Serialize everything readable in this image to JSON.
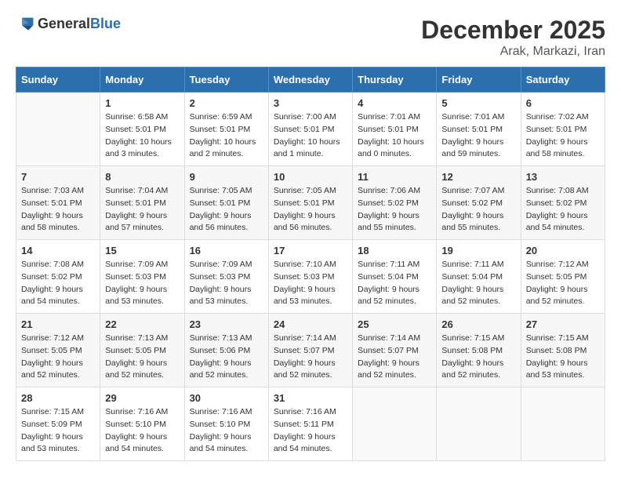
{
  "logo": {
    "general": "General",
    "blue": "Blue"
  },
  "header": {
    "month_year": "December 2025",
    "location": "Arak, Markazi, Iran"
  },
  "days_of_week": [
    "Sunday",
    "Monday",
    "Tuesday",
    "Wednesday",
    "Thursday",
    "Friday",
    "Saturday"
  ],
  "weeks": [
    [
      {
        "day": "",
        "sunrise": "",
        "sunset": "",
        "daylight": ""
      },
      {
        "day": "1",
        "sunrise": "Sunrise: 6:58 AM",
        "sunset": "Sunset: 5:01 PM",
        "daylight": "Daylight: 10 hours and 3 minutes."
      },
      {
        "day": "2",
        "sunrise": "Sunrise: 6:59 AM",
        "sunset": "Sunset: 5:01 PM",
        "daylight": "Daylight: 10 hours and 2 minutes."
      },
      {
        "day": "3",
        "sunrise": "Sunrise: 7:00 AM",
        "sunset": "Sunset: 5:01 PM",
        "daylight": "Daylight: 10 hours and 1 minute."
      },
      {
        "day": "4",
        "sunrise": "Sunrise: 7:01 AM",
        "sunset": "Sunset: 5:01 PM",
        "daylight": "Daylight: 10 hours and 0 minutes."
      },
      {
        "day": "5",
        "sunrise": "Sunrise: 7:01 AM",
        "sunset": "Sunset: 5:01 PM",
        "daylight": "Daylight: 9 hours and 59 minutes."
      },
      {
        "day": "6",
        "sunrise": "Sunrise: 7:02 AM",
        "sunset": "Sunset: 5:01 PM",
        "daylight": "Daylight: 9 hours and 58 minutes."
      }
    ],
    [
      {
        "day": "7",
        "sunrise": "Sunrise: 7:03 AM",
        "sunset": "Sunset: 5:01 PM",
        "daylight": "Daylight: 9 hours and 58 minutes."
      },
      {
        "day": "8",
        "sunrise": "Sunrise: 7:04 AM",
        "sunset": "Sunset: 5:01 PM",
        "daylight": "Daylight: 9 hours and 57 minutes."
      },
      {
        "day": "9",
        "sunrise": "Sunrise: 7:05 AM",
        "sunset": "Sunset: 5:01 PM",
        "daylight": "Daylight: 9 hours and 56 minutes."
      },
      {
        "day": "10",
        "sunrise": "Sunrise: 7:05 AM",
        "sunset": "Sunset: 5:01 PM",
        "daylight": "Daylight: 9 hours and 56 minutes."
      },
      {
        "day": "11",
        "sunrise": "Sunrise: 7:06 AM",
        "sunset": "Sunset: 5:02 PM",
        "daylight": "Daylight: 9 hours and 55 minutes."
      },
      {
        "day": "12",
        "sunrise": "Sunrise: 7:07 AM",
        "sunset": "Sunset: 5:02 PM",
        "daylight": "Daylight: 9 hours and 55 minutes."
      },
      {
        "day": "13",
        "sunrise": "Sunrise: 7:08 AM",
        "sunset": "Sunset: 5:02 PM",
        "daylight": "Daylight: 9 hours and 54 minutes."
      }
    ],
    [
      {
        "day": "14",
        "sunrise": "Sunrise: 7:08 AM",
        "sunset": "Sunset: 5:02 PM",
        "daylight": "Daylight: 9 hours and 54 minutes."
      },
      {
        "day": "15",
        "sunrise": "Sunrise: 7:09 AM",
        "sunset": "Sunset: 5:03 PM",
        "daylight": "Daylight: 9 hours and 53 minutes."
      },
      {
        "day": "16",
        "sunrise": "Sunrise: 7:09 AM",
        "sunset": "Sunset: 5:03 PM",
        "daylight": "Daylight: 9 hours and 53 minutes."
      },
      {
        "day": "17",
        "sunrise": "Sunrise: 7:10 AM",
        "sunset": "Sunset: 5:03 PM",
        "daylight": "Daylight: 9 hours and 53 minutes."
      },
      {
        "day": "18",
        "sunrise": "Sunrise: 7:11 AM",
        "sunset": "Sunset: 5:04 PM",
        "daylight": "Daylight: 9 hours and 52 minutes."
      },
      {
        "day": "19",
        "sunrise": "Sunrise: 7:11 AM",
        "sunset": "Sunset: 5:04 PM",
        "daylight": "Daylight: 9 hours and 52 minutes."
      },
      {
        "day": "20",
        "sunrise": "Sunrise: 7:12 AM",
        "sunset": "Sunset: 5:05 PM",
        "daylight": "Daylight: 9 hours and 52 minutes."
      }
    ],
    [
      {
        "day": "21",
        "sunrise": "Sunrise: 7:12 AM",
        "sunset": "Sunset: 5:05 PM",
        "daylight": "Daylight: 9 hours and 52 minutes."
      },
      {
        "day": "22",
        "sunrise": "Sunrise: 7:13 AM",
        "sunset": "Sunset: 5:05 PM",
        "daylight": "Daylight: 9 hours and 52 minutes."
      },
      {
        "day": "23",
        "sunrise": "Sunrise: 7:13 AM",
        "sunset": "Sunset: 5:06 PM",
        "daylight": "Daylight: 9 hours and 52 minutes."
      },
      {
        "day": "24",
        "sunrise": "Sunrise: 7:14 AM",
        "sunset": "Sunset: 5:07 PM",
        "daylight": "Daylight: 9 hours and 52 minutes."
      },
      {
        "day": "25",
        "sunrise": "Sunrise: 7:14 AM",
        "sunset": "Sunset: 5:07 PM",
        "daylight": "Daylight: 9 hours and 52 minutes."
      },
      {
        "day": "26",
        "sunrise": "Sunrise: 7:15 AM",
        "sunset": "Sunset: 5:08 PM",
        "daylight": "Daylight: 9 hours and 52 minutes."
      },
      {
        "day": "27",
        "sunrise": "Sunrise: 7:15 AM",
        "sunset": "Sunset: 5:08 PM",
        "daylight": "Daylight: 9 hours and 53 minutes."
      }
    ],
    [
      {
        "day": "28",
        "sunrise": "Sunrise: 7:15 AM",
        "sunset": "Sunset: 5:09 PM",
        "daylight": "Daylight: 9 hours and 53 minutes."
      },
      {
        "day": "29",
        "sunrise": "Sunrise: 7:16 AM",
        "sunset": "Sunset: 5:10 PM",
        "daylight": "Daylight: 9 hours and 54 minutes."
      },
      {
        "day": "30",
        "sunrise": "Sunrise: 7:16 AM",
        "sunset": "Sunset: 5:10 PM",
        "daylight": "Daylight: 9 hours and 54 minutes."
      },
      {
        "day": "31",
        "sunrise": "Sunrise: 7:16 AM",
        "sunset": "Sunset: 5:11 PM",
        "daylight": "Daylight: 9 hours and 54 minutes."
      },
      {
        "day": "",
        "sunrise": "",
        "sunset": "",
        "daylight": ""
      },
      {
        "day": "",
        "sunrise": "",
        "sunset": "",
        "daylight": ""
      },
      {
        "day": "",
        "sunrise": "",
        "sunset": "",
        "daylight": ""
      }
    ]
  ]
}
